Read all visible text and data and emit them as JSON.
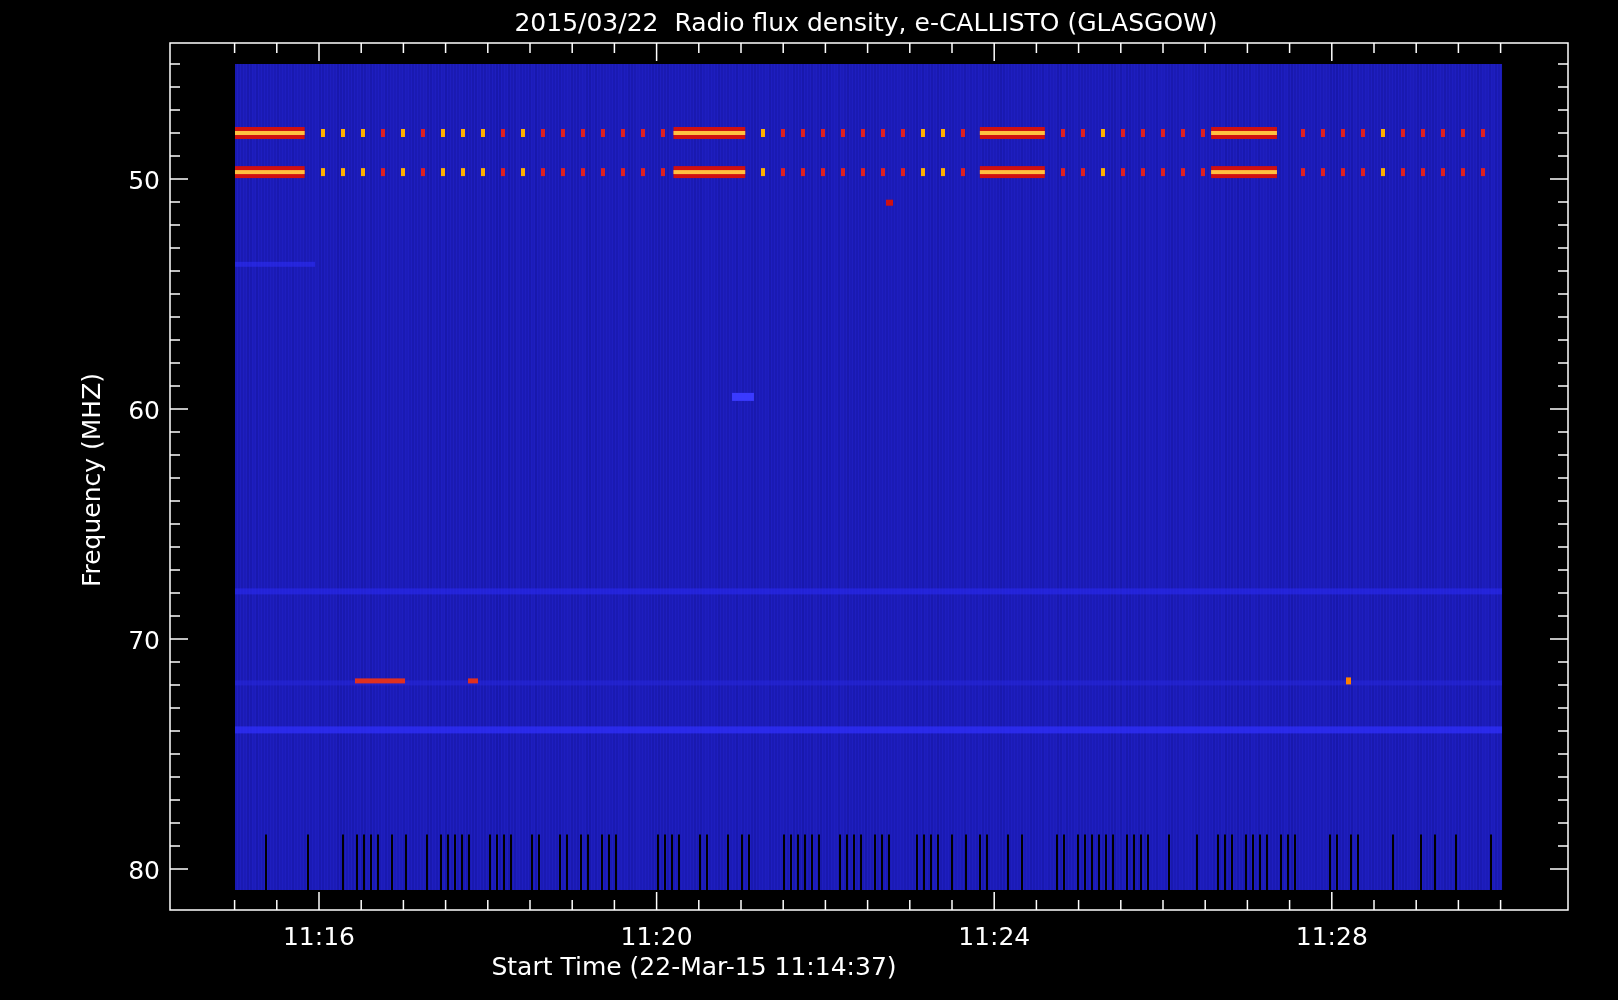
{
  "title": "2015/03/22  Radio flux density, e-CALLISTO (GLASGOW)",
  "ylabel": "Frequency (MHZ)",
  "xlabel": "Start Time (22-Mar-15 11:14:37)",
  "yticks": [
    "50",
    "60",
    "70",
    "80"
  ],
  "xticks": [
    "11:16",
    "11:20",
    "11:24",
    "11:28"
  ]
}
